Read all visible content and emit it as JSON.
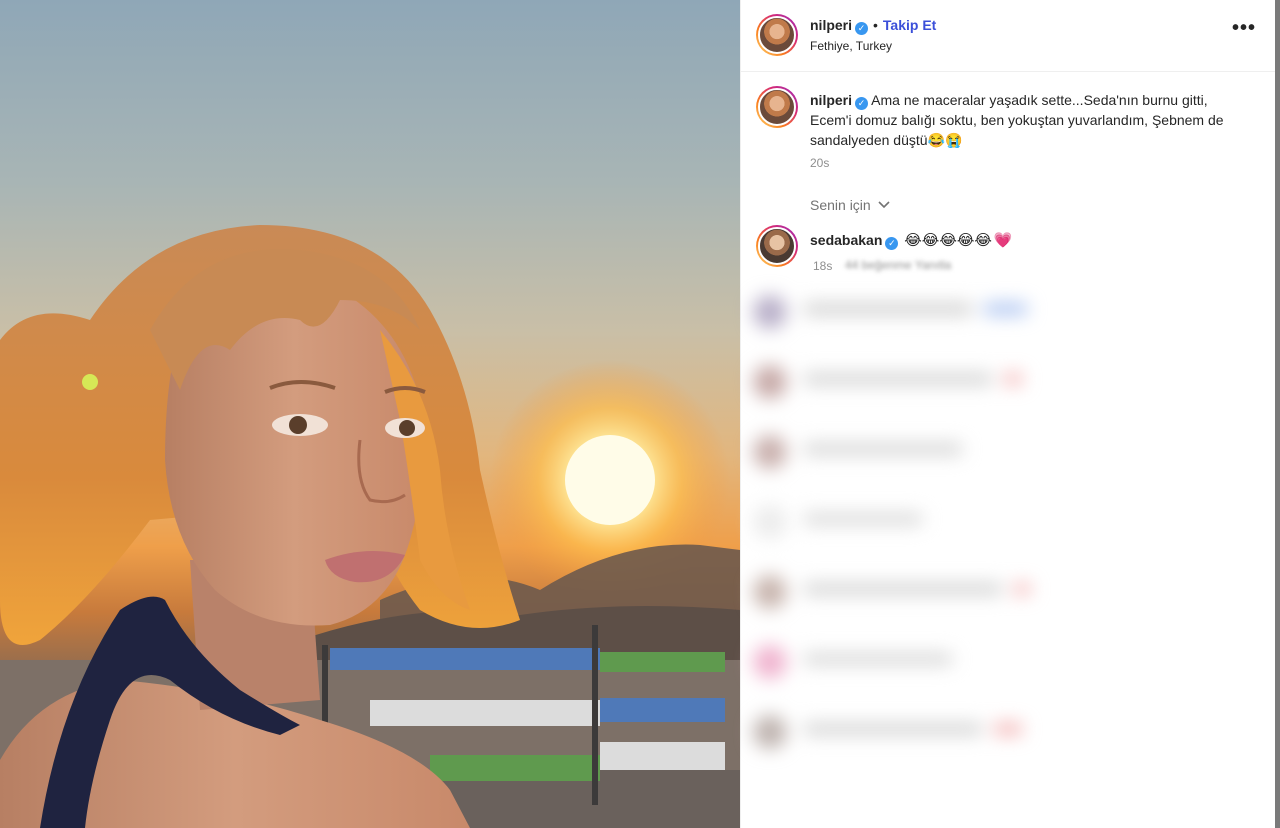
{
  "post": {
    "username": "nilperi",
    "verified_mark": "✓",
    "separator": "•",
    "follow_label": "Takip Et",
    "location": "Fethiye, Turkey",
    "more_label": "•••",
    "caption_text": "Ama ne maceralar yaşadık sette...Seda'nın burnu gitti, Ecem'i domuz balığı soktu, ben yokuştan yuvarlandım, Şebnem de sandalyeden düştü😂😭",
    "time": "20s"
  },
  "comments_section": {
    "filter_label": "Senin için",
    "filter_icon": "chevron-down-icon",
    "first_comment": {
      "username": "sedabakan",
      "emojis": "😂😂😂😂😂",
      "heart": "💗",
      "time": "18s",
      "obscured_text": "44 beğenme   Yanıtla"
    }
  },
  "colors": {
    "link": "#3b4fd9",
    "verified": "#3897f0",
    "muted": "#8e8e8e"
  }
}
